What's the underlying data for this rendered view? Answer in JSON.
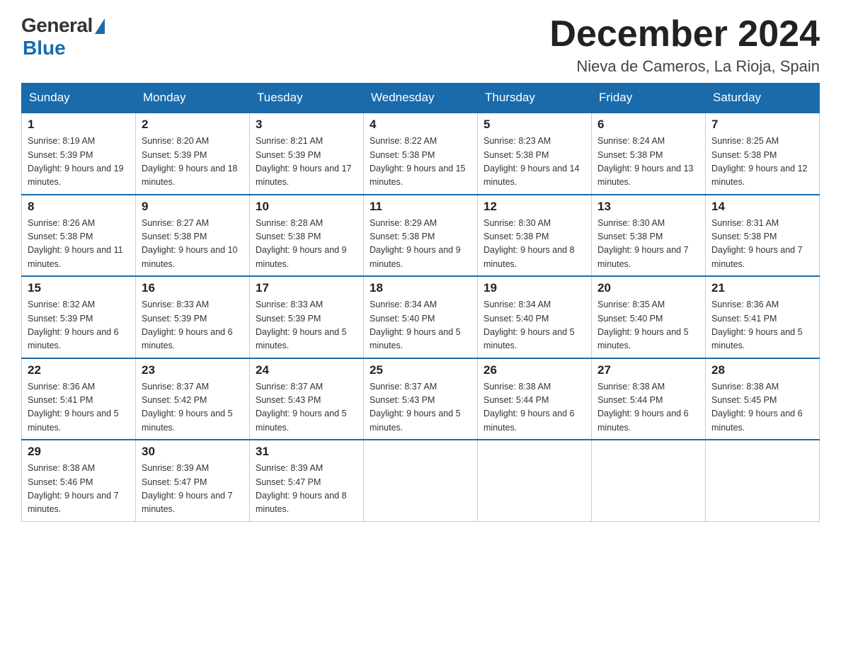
{
  "logo": {
    "general": "General",
    "blue": "Blue"
  },
  "title": "December 2024",
  "location": "Nieva de Cameros, La Rioja, Spain",
  "days_of_week": [
    "Sunday",
    "Monday",
    "Tuesday",
    "Wednesday",
    "Thursday",
    "Friday",
    "Saturday"
  ],
  "weeks": [
    [
      {
        "day": "1",
        "sunrise": "8:19 AM",
        "sunset": "5:39 PM",
        "daylight": "9 hours and 19 minutes."
      },
      {
        "day": "2",
        "sunrise": "8:20 AM",
        "sunset": "5:39 PM",
        "daylight": "9 hours and 18 minutes."
      },
      {
        "day": "3",
        "sunrise": "8:21 AM",
        "sunset": "5:39 PM",
        "daylight": "9 hours and 17 minutes."
      },
      {
        "day": "4",
        "sunrise": "8:22 AM",
        "sunset": "5:38 PM",
        "daylight": "9 hours and 15 minutes."
      },
      {
        "day": "5",
        "sunrise": "8:23 AM",
        "sunset": "5:38 PM",
        "daylight": "9 hours and 14 minutes."
      },
      {
        "day": "6",
        "sunrise": "8:24 AM",
        "sunset": "5:38 PM",
        "daylight": "9 hours and 13 minutes."
      },
      {
        "day": "7",
        "sunrise": "8:25 AM",
        "sunset": "5:38 PM",
        "daylight": "9 hours and 12 minutes."
      }
    ],
    [
      {
        "day": "8",
        "sunrise": "8:26 AM",
        "sunset": "5:38 PM",
        "daylight": "9 hours and 11 minutes."
      },
      {
        "day": "9",
        "sunrise": "8:27 AM",
        "sunset": "5:38 PM",
        "daylight": "9 hours and 10 minutes."
      },
      {
        "day": "10",
        "sunrise": "8:28 AM",
        "sunset": "5:38 PM",
        "daylight": "9 hours and 9 minutes."
      },
      {
        "day": "11",
        "sunrise": "8:29 AM",
        "sunset": "5:38 PM",
        "daylight": "9 hours and 9 minutes."
      },
      {
        "day": "12",
        "sunrise": "8:30 AM",
        "sunset": "5:38 PM",
        "daylight": "9 hours and 8 minutes."
      },
      {
        "day": "13",
        "sunrise": "8:30 AM",
        "sunset": "5:38 PM",
        "daylight": "9 hours and 7 minutes."
      },
      {
        "day": "14",
        "sunrise": "8:31 AM",
        "sunset": "5:38 PM",
        "daylight": "9 hours and 7 minutes."
      }
    ],
    [
      {
        "day": "15",
        "sunrise": "8:32 AM",
        "sunset": "5:39 PM",
        "daylight": "9 hours and 6 minutes."
      },
      {
        "day": "16",
        "sunrise": "8:33 AM",
        "sunset": "5:39 PM",
        "daylight": "9 hours and 6 minutes."
      },
      {
        "day": "17",
        "sunrise": "8:33 AM",
        "sunset": "5:39 PM",
        "daylight": "9 hours and 5 minutes."
      },
      {
        "day": "18",
        "sunrise": "8:34 AM",
        "sunset": "5:40 PM",
        "daylight": "9 hours and 5 minutes."
      },
      {
        "day": "19",
        "sunrise": "8:34 AM",
        "sunset": "5:40 PM",
        "daylight": "9 hours and 5 minutes."
      },
      {
        "day": "20",
        "sunrise": "8:35 AM",
        "sunset": "5:40 PM",
        "daylight": "9 hours and 5 minutes."
      },
      {
        "day": "21",
        "sunrise": "8:36 AM",
        "sunset": "5:41 PM",
        "daylight": "9 hours and 5 minutes."
      }
    ],
    [
      {
        "day": "22",
        "sunrise": "8:36 AM",
        "sunset": "5:41 PM",
        "daylight": "9 hours and 5 minutes."
      },
      {
        "day": "23",
        "sunrise": "8:37 AM",
        "sunset": "5:42 PM",
        "daylight": "9 hours and 5 minutes."
      },
      {
        "day": "24",
        "sunrise": "8:37 AM",
        "sunset": "5:43 PM",
        "daylight": "9 hours and 5 minutes."
      },
      {
        "day": "25",
        "sunrise": "8:37 AM",
        "sunset": "5:43 PM",
        "daylight": "9 hours and 5 minutes."
      },
      {
        "day": "26",
        "sunrise": "8:38 AM",
        "sunset": "5:44 PM",
        "daylight": "9 hours and 6 minutes."
      },
      {
        "day": "27",
        "sunrise": "8:38 AM",
        "sunset": "5:44 PM",
        "daylight": "9 hours and 6 minutes."
      },
      {
        "day": "28",
        "sunrise": "8:38 AM",
        "sunset": "5:45 PM",
        "daylight": "9 hours and 6 minutes."
      }
    ],
    [
      {
        "day": "29",
        "sunrise": "8:38 AM",
        "sunset": "5:46 PM",
        "daylight": "9 hours and 7 minutes."
      },
      {
        "day": "30",
        "sunrise": "8:39 AM",
        "sunset": "5:47 PM",
        "daylight": "9 hours and 7 minutes."
      },
      {
        "day": "31",
        "sunrise": "8:39 AM",
        "sunset": "5:47 PM",
        "daylight": "9 hours and 8 minutes."
      },
      null,
      null,
      null,
      null
    ]
  ]
}
